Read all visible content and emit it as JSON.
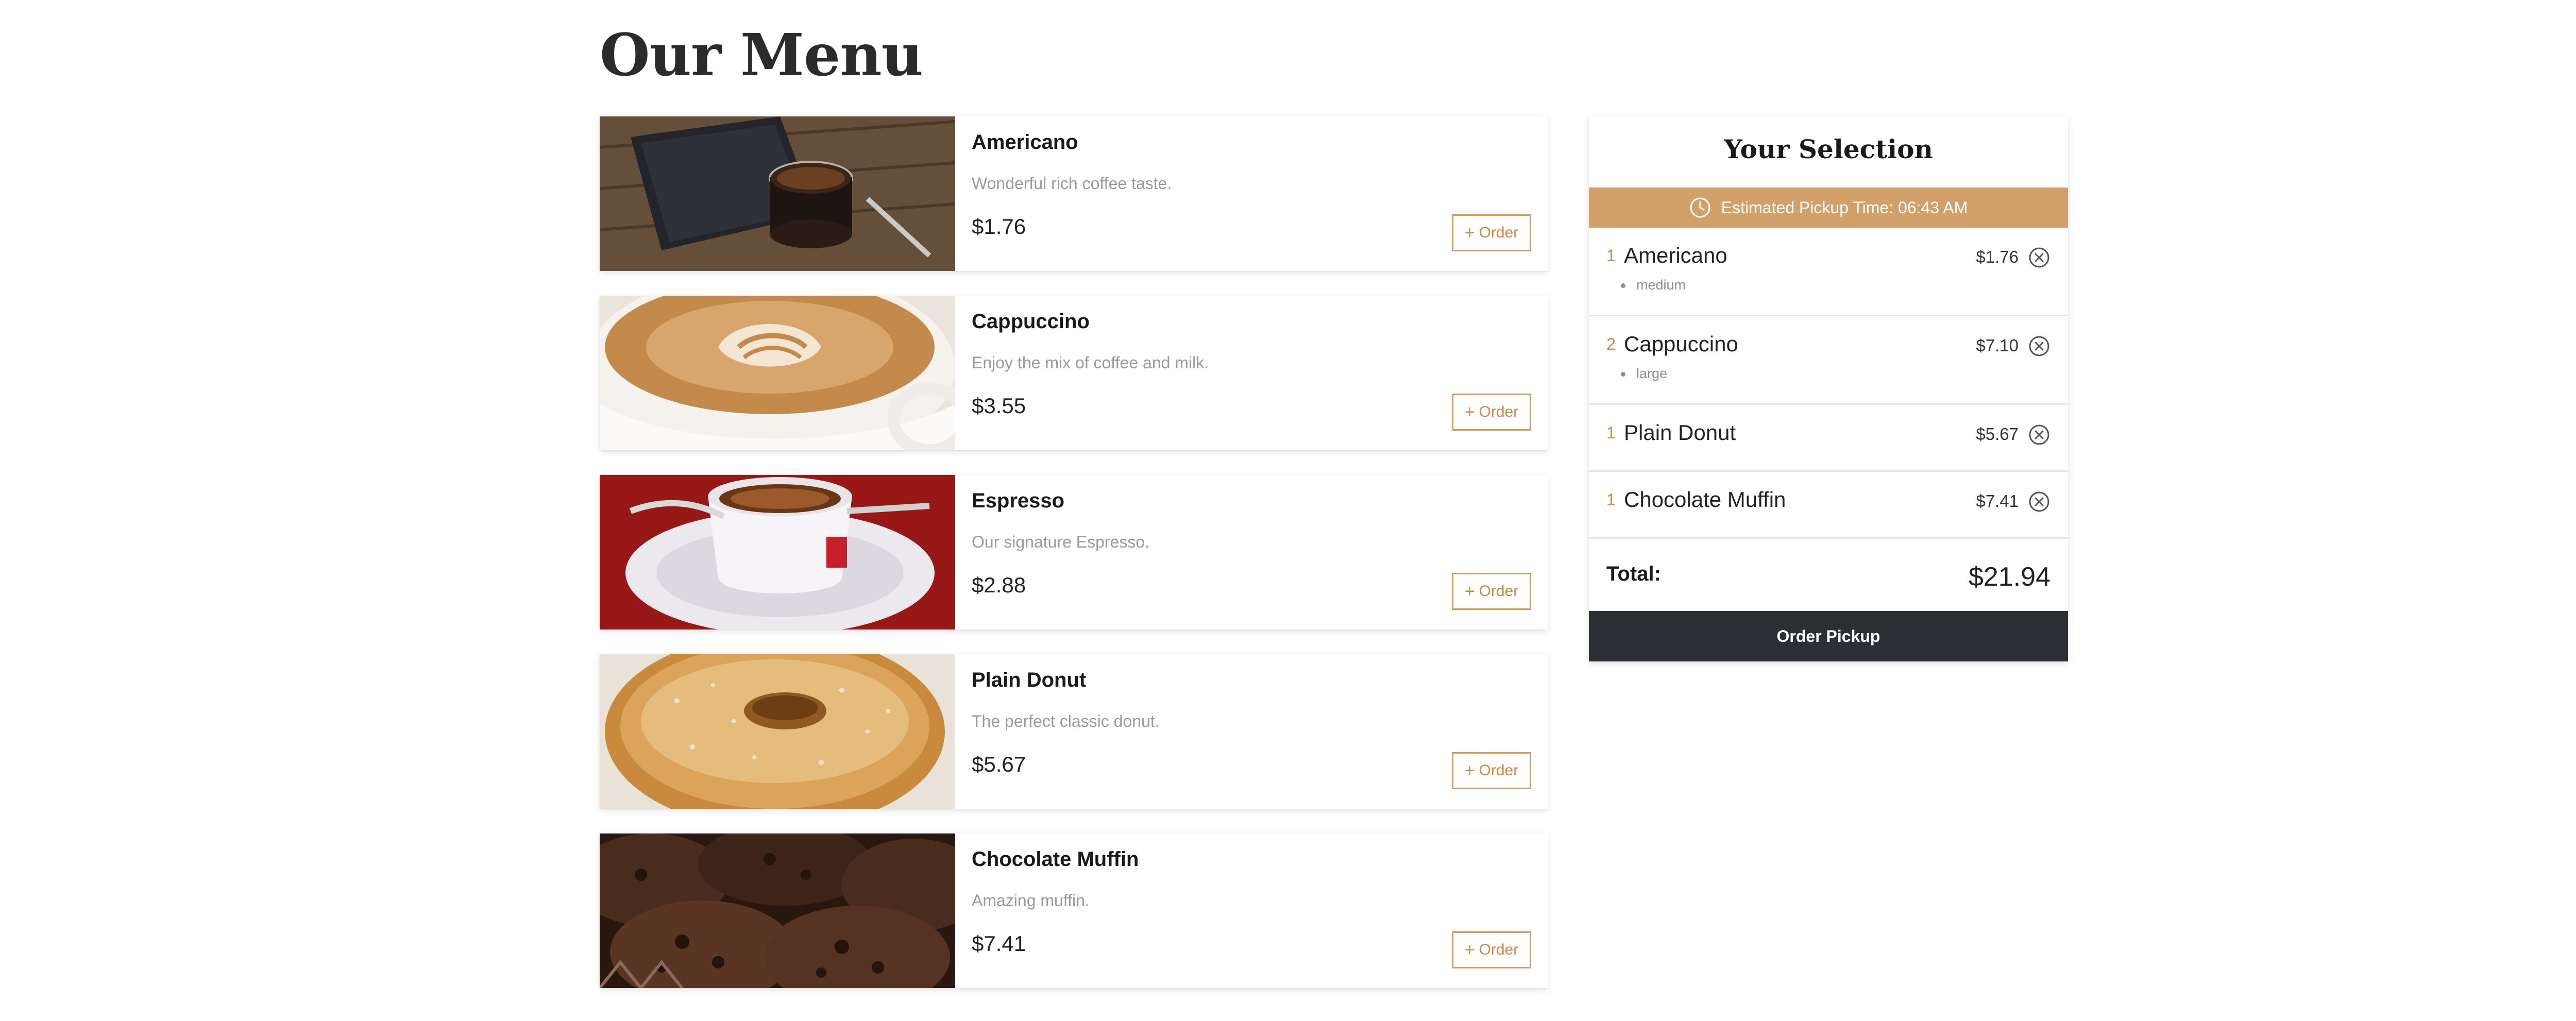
{
  "page": {
    "title": "Our Menu"
  },
  "menu": {
    "items": [
      {
        "name": "Americano",
        "description": "Wonderful rich coffee taste.",
        "price": "$1.76",
        "order_label": "Order",
        "image": "americano-photo"
      },
      {
        "name": "Cappuccino",
        "description": "Enjoy the mix of coffee and milk.",
        "price": "$3.55",
        "order_label": "Order",
        "image": "cappuccino-photo"
      },
      {
        "name": "Espresso",
        "description": "Our signature Espresso.",
        "price": "$2.88",
        "order_label": "Order",
        "image": "espresso-photo"
      },
      {
        "name": "Plain Donut",
        "description": "The perfect classic donut.",
        "price": "$5.67",
        "order_label": "Order",
        "image": "donut-photo"
      },
      {
        "name": "Chocolate Muffin",
        "description": "Amazing muffin.",
        "price": "$7.41",
        "order_label": "Order",
        "image": "muffin-photo"
      }
    ]
  },
  "selection": {
    "title": "Your Selection",
    "pickup_text": "Estimated Pickup Time: 06:43 AM",
    "pickup_icon": "clock-icon",
    "rows": [
      {
        "qty": "1",
        "name": "Americano",
        "size": "medium",
        "price": "$1.76"
      },
      {
        "qty": "2",
        "name": "Cappuccino",
        "size": "large",
        "price": "$7.10"
      },
      {
        "qty": "1",
        "name": "Plain Donut",
        "price": "$5.67"
      },
      {
        "qty": "1",
        "name": "Chocolate Muffin",
        "price": "$7.41"
      }
    ],
    "total_label": "Total:",
    "total_value": "$21.94",
    "checkout_label": "Order Pickup"
  },
  "colors": {
    "accent": "#d1a06b",
    "accent_text": "#c98a48",
    "dark_button": "#2c2f33"
  }
}
